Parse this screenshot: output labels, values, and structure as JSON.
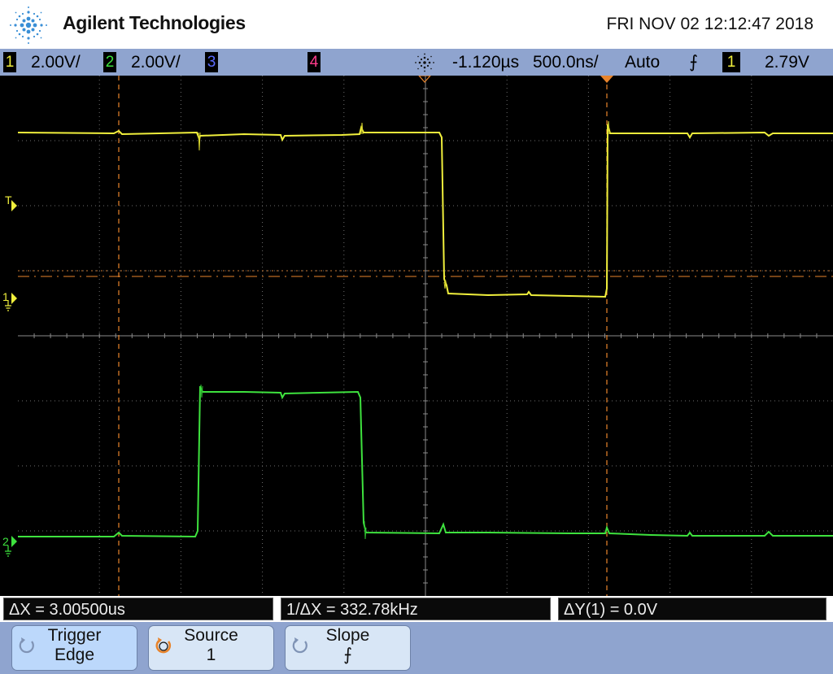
{
  "header": {
    "brand": "Agilent Technologies",
    "datetime": "FRI NOV 02 12:12:47 2018"
  },
  "status_bar": {
    "ch1": {
      "label": "1",
      "scale": "2.00V/"
    },
    "ch2": {
      "label": "2",
      "scale": "2.00V/"
    },
    "ch3": {
      "label": "3"
    },
    "ch4": {
      "label": "4"
    },
    "time_delay": "-1.120µs",
    "time_scale": "500.0ns/",
    "trigger_mode": "Auto",
    "trigger_slope_symbol": "⨍",
    "trigger_channel": "1",
    "trigger_level": "2.79V"
  },
  "screen": {
    "trigger_marker": "T",
    "ch1_ground_marker": "1",
    "ch2_ground_marker": "2"
  },
  "measurements": {
    "delta_x": "ΔX = 3.00500us",
    "inv_delta_x": "1/ΔX = 332.78kHz",
    "delta_y": "ΔY(1) = 0.0V"
  },
  "softkeys": [
    {
      "line1": "Trigger",
      "line2": "Edge"
    },
    {
      "line1": "Source",
      "line2": "1"
    },
    {
      "line1": "Slope",
      "line2": "⨍"
    }
  ],
  "colors": {
    "ch1": "#f0ef3c",
    "ch2": "#3ee23e",
    "cursor": "#e8842c",
    "grid": "#6e6e6e",
    "toolbar": "#8fa4cf"
  }
}
